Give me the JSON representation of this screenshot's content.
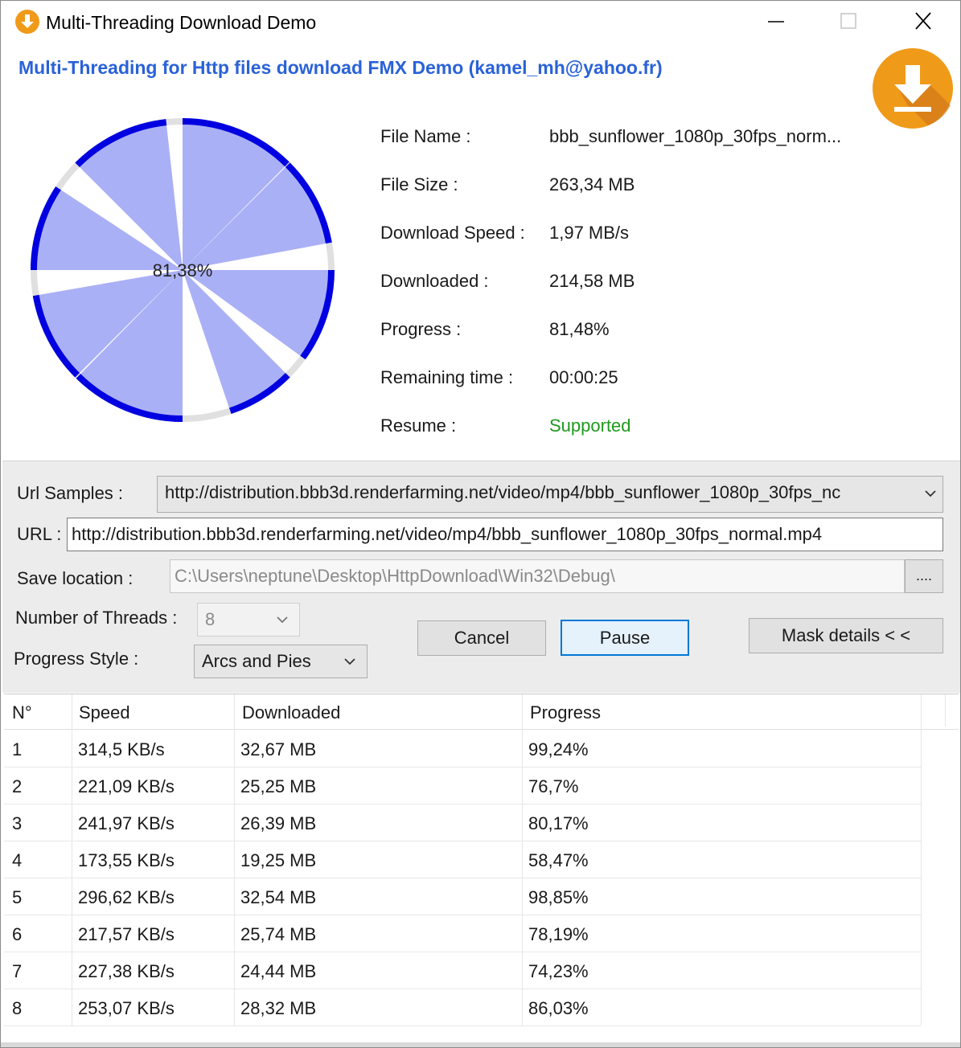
{
  "window": {
    "title": "Multi-Threading Download Demo",
    "icon": "download-app-icon"
  },
  "heading": "Multi-Threading for Http files download FMX Demo (kamel_mh@yahoo.fr)",
  "colors": {
    "accent": "#2a62d8",
    "pie_fill": "#aab0f5",
    "pie_arc": "#0000e0",
    "supported": "#1f9a1f",
    "logo": "#f09a1a"
  },
  "progress_chart": {
    "type": "pie",
    "center_label": "81,38%",
    "threads_progress_percent": [
      99.24,
      76.7,
      80.17,
      58.47,
      98.85,
      78.19,
      74.23,
      86.03
    ]
  },
  "info": {
    "file_name_label": "File Name :",
    "file_name": "bbb_sunflower_1080p_30fps_norm...",
    "file_size_label": "File Size :",
    "file_size": "263,34 MB",
    "speed_label": "Download Speed :",
    "speed": "1,97 MB/s",
    "downloaded_label": "Downloaded  :",
    "downloaded": "214,58 MB",
    "progress_label": "Progress :",
    "progress": "81,48%",
    "remaining_label": "Remaining time :",
    "remaining": "00:00:25",
    "resume_label": "Resume :",
    "resume": "Supported"
  },
  "controls": {
    "url_samples_label": "Url Samples :",
    "url_samples_value": "http://distribution.bbb3d.renderfarming.net/video/mp4/bbb_sunflower_1080p_30fps_nc",
    "url_label": "URL :",
    "url_value": "http://distribution.bbb3d.renderfarming.net/video/mp4/bbb_sunflower_1080p_30fps_normal.mp4",
    "save_label": "Save location :",
    "save_value": "C:\\Users\\neptune\\Desktop\\HttpDownload\\Win32\\Debug\\",
    "browse_label": "....",
    "threads_label": "Number of Threads :",
    "threads_value": "8",
    "style_label": "Progress Style :",
    "style_value": "Arcs and Pies",
    "cancel_label": "Cancel",
    "pause_label": "Pause",
    "mask_label": "Mask details < <"
  },
  "table": {
    "headers": [
      "N°",
      "Speed",
      "Downloaded",
      "Progress"
    ],
    "rows": [
      [
        "1",
        "314,5 KB/s",
        "32,67 MB",
        "99,24%"
      ],
      [
        "2",
        "221,09 KB/s",
        "25,25 MB",
        "76,7%"
      ],
      [
        "3",
        "241,97 KB/s",
        "26,39 MB",
        "80,17%"
      ],
      [
        "4",
        "173,55 KB/s",
        "19,25 MB",
        "58,47%"
      ],
      [
        "5",
        "296,62 KB/s",
        "32,54 MB",
        "98,85%"
      ],
      [
        "6",
        "217,57 KB/s",
        "25,74 MB",
        "78,19%"
      ],
      [
        "7",
        "227,38 KB/s",
        "24,44 MB",
        "74,23%"
      ],
      [
        "8",
        "253,07 KB/s",
        "28,32 MB",
        "86,03%"
      ]
    ]
  }
}
